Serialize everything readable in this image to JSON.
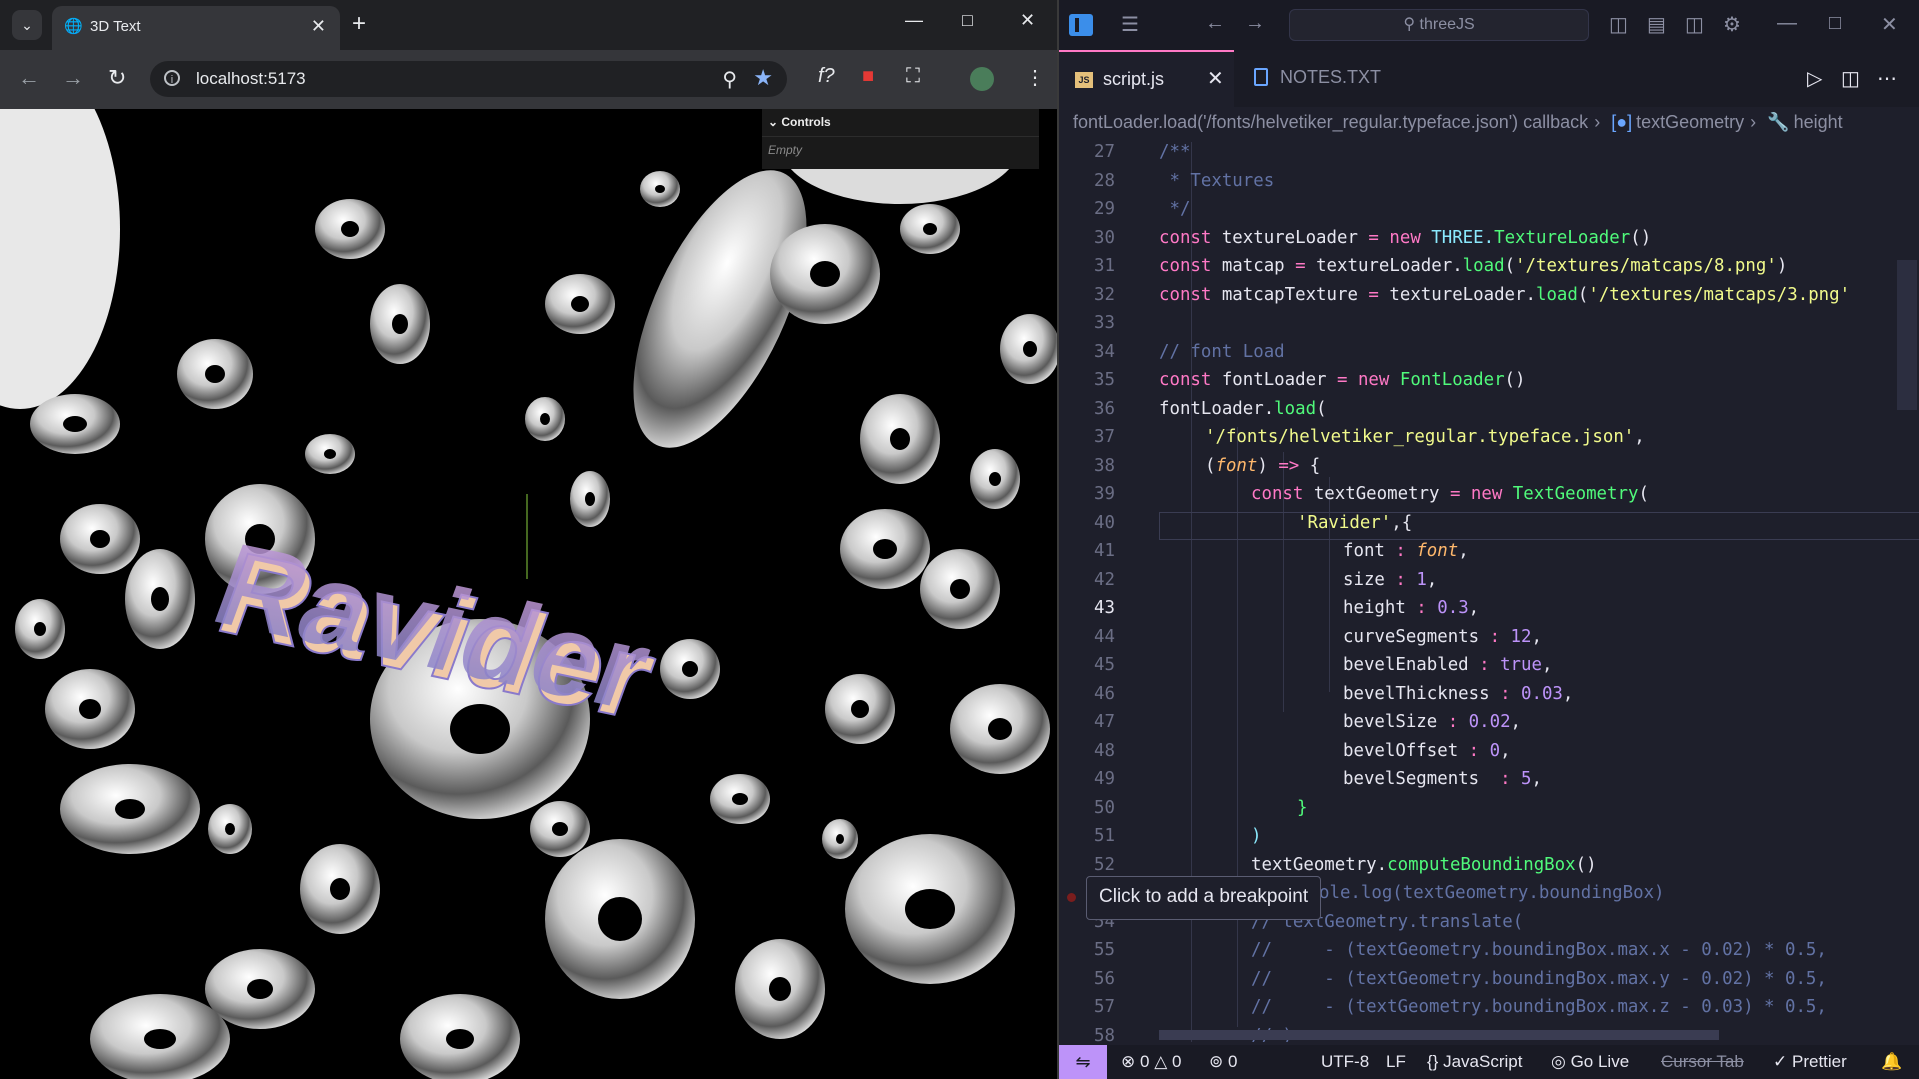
{
  "browser": {
    "tab_title": "3D Text",
    "url": "localhost:5173",
    "icons": [
      "tab-search-icon",
      "globe-icon",
      "close-icon",
      "new-tab-icon",
      "minimize-icon",
      "maximize-icon",
      "close-window-icon",
      "back-icon",
      "forward-icon",
      "reload-icon",
      "site-info-icon",
      "zoom-icon",
      "bookmark-star-icon",
      "function-extension-icon",
      "lock-extension-icon",
      "extensions-puzzle-icon",
      "profile-avatar-icon",
      "menu-icon"
    ]
  },
  "scene": {
    "text": "Ravider",
    "controls_title": "Controls",
    "controls_empty": "Empty"
  },
  "editor": {
    "search": "threeJS",
    "tabs": [
      {
        "label": "script.js",
        "icon_label": "JS"
      },
      {
        "label": "NOTES.TXT"
      }
    ],
    "breadcrumb": {
      "callback": "fontLoader.load('/fonts/helvetiker_regular.typeface.json') callback",
      "symbol": "textGeometry",
      "prop": "height"
    },
    "tooltip": "Click to add a breakpoint",
    "current_line": 43,
    "lines": [
      {
        "n": "27"
      },
      {
        "n": "28"
      },
      {
        "n": "29"
      },
      {
        "n": "30"
      },
      {
        "n": "31"
      },
      {
        "n": "32"
      },
      {
        "n": "33"
      },
      {
        "n": "34"
      },
      {
        "n": "35"
      },
      {
        "n": "36"
      },
      {
        "n": "37"
      },
      {
        "n": "38"
      },
      {
        "n": "39"
      },
      {
        "n": "40"
      },
      {
        "n": "41"
      },
      {
        "n": "42"
      },
      {
        "n": "43"
      },
      {
        "n": "44"
      },
      {
        "n": "45"
      },
      {
        "n": "46"
      },
      {
        "n": "47"
      },
      {
        "n": "48"
      },
      {
        "n": "49"
      },
      {
        "n": "50"
      },
      {
        "n": "51"
      },
      {
        "n": "52"
      },
      {
        "n": "53"
      },
      {
        "n": "54"
      },
      {
        "n": "55"
      },
      {
        "n": "56"
      },
      {
        "n": "57"
      },
      {
        "n": "58"
      }
    ],
    "code": {
      "l27": "/**",
      "l28": " * Textures",
      "l29": " */",
      "l30_a": "const",
      "l30_b": " textureLoader ",
      "l30_c": "=",
      "l30_d": " new ",
      "l30_e": "THREE.",
      "l30_f": "TextureLoader",
      "l30_g": "()",
      "l31_a": "const",
      "l31_b": " matcap ",
      "l31_c": "=",
      "l31_d": " textureLoader.",
      "l31_e": "load",
      "l31_f": "(",
      "l31_g": "'/textures/matcaps/8.png'",
      "l31_h": ")",
      "l32_a": "const",
      "l32_b": " matcapTexture ",
      "l32_c": "=",
      "l32_d": " textureLoader.",
      "l32_e": "load",
      "l32_f": "(",
      "l32_g": "'/textures/matcaps/3.png'",
      "l34": "// font Load",
      "l35_a": "const",
      "l35_b": " fontLoader ",
      "l35_c": "=",
      "l35_d": " new ",
      "l35_e": "FontLoader",
      "l35_f": "()",
      "l36_a": "fontLoader.",
      "l36_b": "load",
      "l36_c": "(",
      "l37_a": "'/fonts/helvetiker_regular.typeface.json'",
      "l37_b": ",",
      "l38_a": "(",
      "l38_b": "font",
      "l38_c": ")",
      "l38_d": " => ",
      "l38_e": "{",
      "l39_a": "const",
      "l39_b": " textGeometry ",
      "l39_c": "=",
      "l39_d": " new ",
      "l39_e": "TextGeometry",
      "l39_f": "(",
      "l40_a": "'Ravider'",
      "l40_b": ",{",
      "l41_a": "font ",
      "l41_b": ":",
      "l41_c": " font",
      "l41_d": ",",
      "l42_a": "size ",
      "l42_b": ":",
      "l42_c": " 1",
      "l42_d": ",",
      "l43_a": "height ",
      "l43_b": ":",
      "l43_c": " 0.3",
      "l43_d": ",",
      "l44_a": "curveSegments ",
      "l44_b": ":",
      "l44_c": " 12",
      "l44_d": ",",
      "l45_a": "bevelEnabled ",
      "l45_b": ":",
      "l45_c": " true",
      "l45_d": ",",
      "l46_a": "bevelThickness ",
      "l46_b": ":",
      "l46_c": " 0.03",
      "l46_d": ",",
      "l47_a": "bevelSize ",
      "l47_b": ":",
      "l47_c": " 0.02",
      "l47_d": ",",
      "l48_a": "bevelOffset ",
      "l48_b": ":",
      "l48_c": " 0",
      "l48_d": ",",
      "l49_a": "bevelSegments  ",
      "l49_b": ":",
      "l49_c": " 5",
      "l49_d": ",",
      "l50": "}",
      "l51": ")",
      "l52_a": "textGeometry.",
      "l52_b": "computeBoundingBox",
      "l52_c": "()",
      "l53": "ole.log(textGeometry.boundingBox)",
      "l54": "// textGeometry.translate(",
      "l55": "//     - (textGeometry.boundingBox.max.x - 0.02) * 0.5,",
      "l56": "//     - (textGeometry.boundingBox.max.y - 0.02) * 0.5,",
      "l57": "//     - (textGeometry.boundingBox.max.z - 0.03) * 0.5,",
      "l58": "// )"
    },
    "status": {
      "errors": "0",
      "warnings": "0",
      "ports": "0",
      "encoding": "UTF-8",
      "eol": "LF",
      "language": "JavaScript",
      "golive": "Go Live",
      "cursortab": "Cursor Tab",
      "prettier": "Prettier"
    }
  },
  "colors": {
    "accent_pink": "#ff79c6",
    "keyword": "#ff79c6",
    "function": "#50fa7b",
    "string": "#f1fa8c",
    "number": "#bd93f9",
    "comment": "#6272a4",
    "status_remote": "#bd93f9"
  }
}
